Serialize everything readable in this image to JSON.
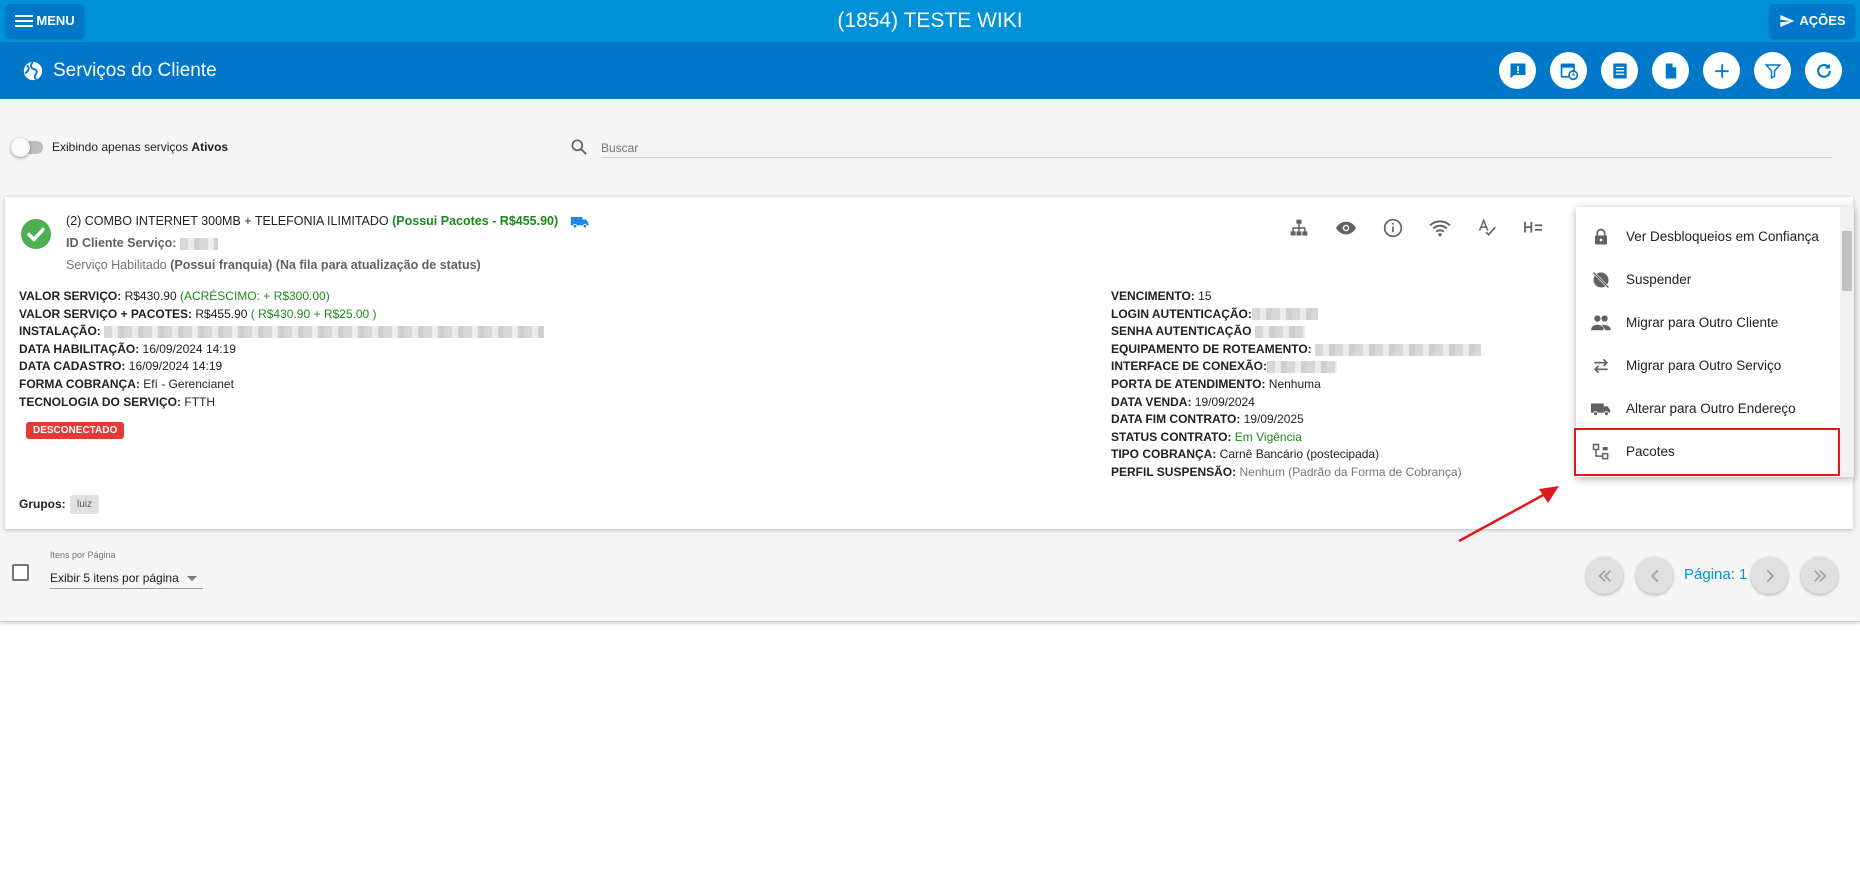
{
  "topbar": {
    "menu_label": "MENU",
    "title": "(1854) TESTE WIKI",
    "actions_label": "AÇÕES"
  },
  "header": {
    "title": "Serviços do Cliente",
    "action_icons": [
      "alert-icon",
      "calendar-clock-icon",
      "list-icon",
      "document-icon",
      "add-icon",
      "filter-icon",
      "refresh-icon"
    ]
  },
  "filters": {
    "toggle_text": "Exibindo apenas serviços ",
    "toggle_bold": "Ativos",
    "search_placeholder": "Buscar"
  },
  "service": {
    "title": "(2) COMBO INTERNET 300MB + TELEFONIA ILIMITADO",
    "packages_note": "(Possui Pacotes - R$455.90)",
    "id_label": "ID Cliente Serviço:",
    "status_text": "Serviço Habilitado ",
    "status_bold": "(Possui franquia) (Na fila para atualização de status)",
    "left_fields": {
      "valor_label": "VALOR SERVIÇO:",
      "valor_value": "R$430.90",
      "valor_extra": "(ACRÉSCIMO: + R$300.00)",
      "valor_pacotes_label": "VALOR SERVIÇO + PACOTES:",
      "valor_pacotes_value": "R$455.90",
      "valor_pacotes_extra": "( R$430.90 + R$25.00 )",
      "instalacao_label": "INSTALAÇÃO:",
      "habilitacao_label": "DATA HABILITAÇÃO:",
      "habilitacao_value": "16/09/2024 14:19",
      "cadastro_label": "DATA CADASTRO:",
      "cadastro_value": "16/09/2024 14:19",
      "cobranca_label": "FORMA COBRANÇA:",
      "cobranca_value": "Efí - Gerencianet",
      "tecnologia_label": "TECNOLOGIA DO SERVIÇO:",
      "tecnologia_value": "FTTH"
    },
    "right_fields": {
      "vencimento_label": "VENCIMENTO:",
      "vencimento_value": "15",
      "login_label": "LOGIN AUTENTICAÇÃO:",
      "senha_label": "SENHA AUTENTICAÇÃO",
      "equip_label": "EQUIPAMENTO DE ROTEAMENTO:",
      "interface_label": "INTERFACE DE CONEXÃO:",
      "porta_label": "PORTA DE ATENDIMENTO:",
      "porta_value": "Nenhuma",
      "venda_label": "DATA VENDA:",
      "venda_value": "19/09/2024",
      "fim_label": "DATA FIM CONTRATO:",
      "fim_value": "19/09/2025",
      "status_label": "STATUS CONTRATO:",
      "status_value": "Em Vigência",
      "tipo_label": "TIPO COBRANÇA:",
      "tipo_value": "Carnê Bancário (postecipada)",
      "perfil_label": "PERFIL SUSPENSÃO:",
      "perfil_value": "Nenhum (Padrão da Forma de Cobrança)"
    },
    "badge": "DESCONECTADO",
    "groups_label": "Grupos:",
    "group_chip": "luiz",
    "card_icons": [
      "sitemap-icon",
      "eye-icon",
      "info-icon",
      "wifi-icon",
      "spellcheck-icon",
      "format-list-icon"
    ]
  },
  "dropdown": {
    "items": [
      {
        "label": "Ver Desbloqueios em Confiança",
        "icon": "lock-icon"
      },
      {
        "label": "Suspender",
        "icon": "web-off-icon"
      },
      {
        "label": "Migrar para Outro Cliente",
        "icon": "people-icon"
      },
      {
        "label": "Migrar para Outro Serviço",
        "icon": "swap-icon"
      },
      {
        "label": "Alterar para Outro Endereço",
        "icon": "truck-icon"
      },
      {
        "label": "Pacotes",
        "icon": "package-icon"
      }
    ],
    "highlight_color": "#e0191f"
  },
  "pagination": {
    "items_per_page_label": "Itens por Página",
    "items_per_page_value": "Exibir 5 itens por página",
    "page_label": "Página: 1"
  },
  "colors": {
    "topbar": "#0091d9",
    "header": "#0077c8",
    "green": "#1b8a1b",
    "badge": "#e53935"
  }
}
